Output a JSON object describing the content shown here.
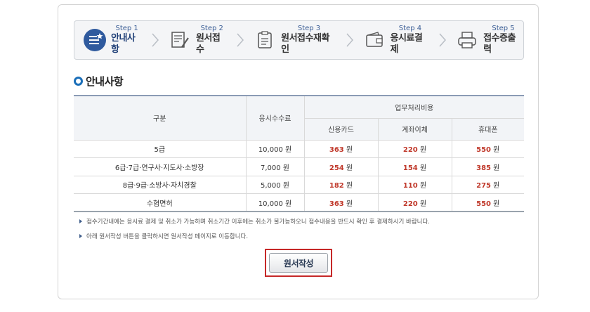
{
  "steps": [
    {
      "num": "Step 1",
      "label": "안내사항",
      "icon": "list-star-icon"
    },
    {
      "num": "Step 2",
      "label": "원서접수",
      "icon": "form-pen-icon"
    },
    {
      "num": "Step 3",
      "label": "원서접수재확인",
      "icon": "clipboard-icon"
    },
    {
      "num": "Step 4",
      "label": "응시료결제",
      "icon": "wallet-icon"
    },
    {
      "num": "Step 5",
      "label": "접수증출력",
      "icon": "printer-icon"
    }
  ],
  "section_title": "안내사항",
  "table": {
    "headers": {
      "category": "구분",
      "exam_fee": "응시수수료",
      "processing_fee": "업무처리비용",
      "card": "신용카드",
      "transfer": "계좌이체",
      "phone": "휴대폰"
    },
    "rows": [
      {
        "category": "5급",
        "exam_fee": "10,000 원",
        "card": "363",
        "transfer": "220",
        "phone": "550"
      },
      {
        "category": "6급·7급·연구사·지도사·소방장",
        "exam_fee": "7,000 원",
        "card": "254",
        "transfer": "154",
        "phone": "385"
      },
      {
        "category": "8급·9급·소방사·자치경찰",
        "exam_fee": "5,000 원",
        "card": "182",
        "transfer": "110",
        "phone": "275"
      },
      {
        "category": "수협면허",
        "exam_fee": "10,000 원",
        "card": "363",
        "transfer": "220",
        "phone": "550"
      }
    ],
    "won": "원"
  },
  "notes": [
    "접수기간내에는 응시료 결제 및 취소가 가능하며 취소기간 이후에는 취소가 불가능하오니 접수내용을 반드시 확인 후 결제하시기 바랍니다.",
    "아래 원서작성 버튼을 클릭하시면 원서작성 페이지로 이동합니다."
  ],
  "apply_button": "원서작성",
  "colors": {
    "accent": "#1b6fb9",
    "highlight": "#c62828",
    "fee_red": "#c0392b"
  }
}
